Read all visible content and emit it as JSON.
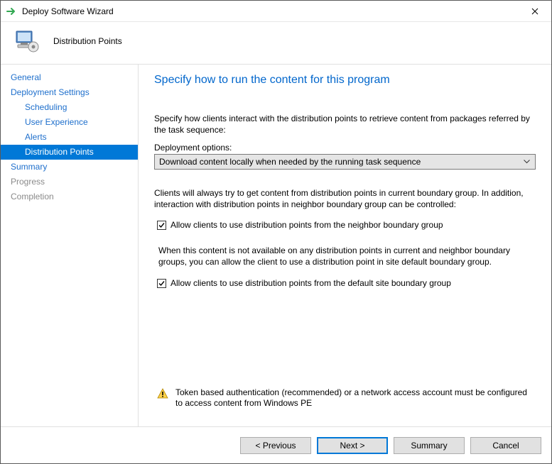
{
  "window": {
    "title": "Deploy Software Wizard"
  },
  "header": {
    "subtitle": "Distribution Points"
  },
  "sidebar": {
    "items": [
      {
        "label": "General",
        "child": false,
        "selected": false,
        "disabled": false
      },
      {
        "label": "Deployment Settings",
        "child": false,
        "selected": false,
        "disabled": false
      },
      {
        "label": "Scheduling",
        "child": true,
        "selected": false,
        "disabled": false
      },
      {
        "label": "User Experience",
        "child": true,
        "selected": false,
        "disabled": false
      },
      {
        "label": "Alerts",
        "child": true,
        "selected": false,
        "disabled": false
      },
      {
        "label": "Distribution Points",
        "child": true,
        "selected": true,
        "disabled": false
      },
      {
        "label": "Summary",
        "child": false,
        "selected": false,
        "disabled": false
      },
      {
        "label": "Progress",
        "child": false,
        "selected": false,
        "disabled": true
      },
      {
        "label": "Completion",
        "child": false,
        "selected": false,
        "disabled": true
      }
    ]
  },
  "main": {
    "heading": "Specify how to run the content for this program",
    "description1": "Specify how clients interact with the distribution points to retrieve content from packages referred by the task sequence:",
    "dropdown_label": "Deployment options:",
    "dropdown_value": "Download content locally when needed by the running task sequence",
    "description2": "Clients will always try to get content from distribution points in current boundary group. In addition, interaction with distribution points in neighbor boundary group can be controlled:",
    "checkbox1": {
      "checked": true,
      "label": "Allow clients to use distribution points from the neighbor boundary group"
    },
    "description3": "When this content is not available on any distribution points in current and neighbor boundary groups, you can allow the client to use a distribution point in site default boundary group.",
    "checkbox2": {
      "checked": true,
      "label": "Allow clients to use distribution points from the default site boundary group"
    },
    "warning": "Token based authentication (recommended) or a network access account must be configured to access content from Windows PE"
  },
  "footer": {
    "previous": "< Previous",
    "next": "Next >",
    "summary": "Summary",
    "cancel": "Cancel"
  }
}
